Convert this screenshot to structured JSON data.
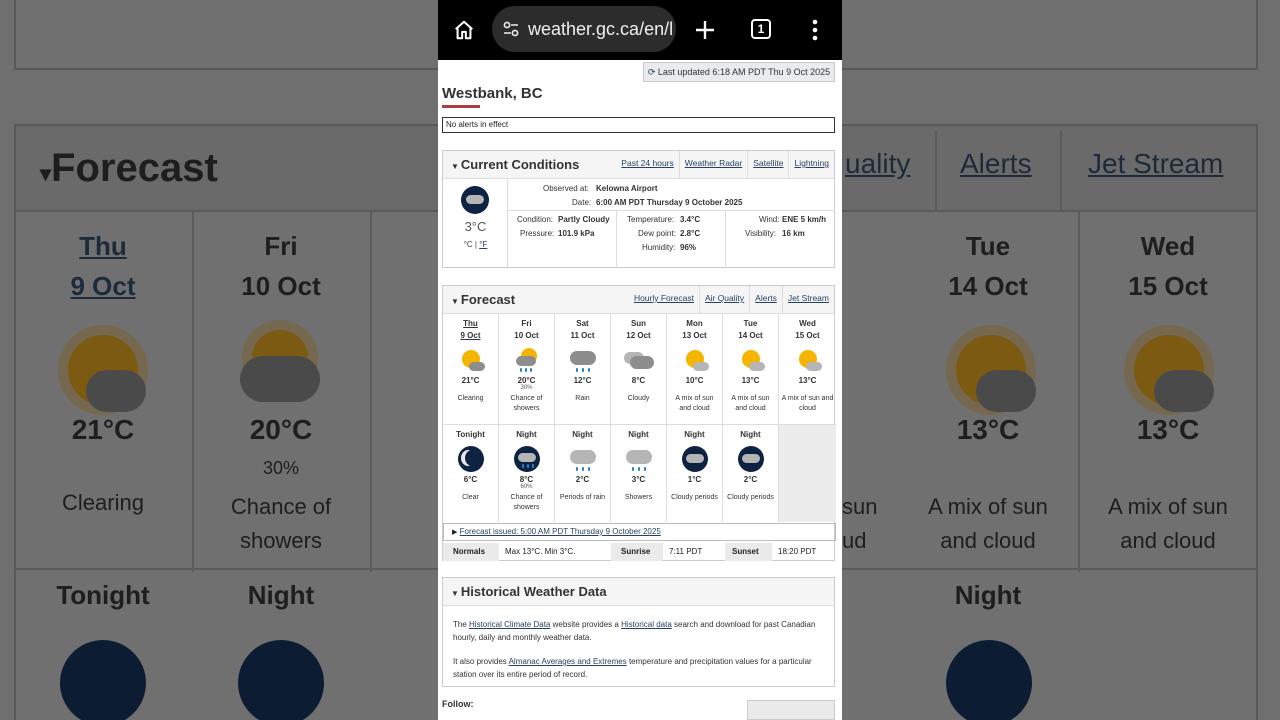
{
  "browser": {
    "url": "weather.gc.ca/en/l",
    "tab_count": "1"
  },
  "page": {
    "last_updated": "Last updated 6:18 AM PDT Thu 9 Oct 2025",
    "city": "Westbank, BC",
    "alerts": "No alerts in effect"
  },
  "current": {
    "title": "Current Conditions",
    "links": [
      "Past 24 hours",
      "Weather Radar",
      "Satellite",
      "Lightning"
    ],
    "temp": "3°C",
    "unit_c": "°C",
    "unit_f": "°F",
    "observed_label": "Observed at:",
    "observed_value": "Kelowna Airport",
    "date_label": "Date:",
    "date_value": "6:00 AM PDT Thursday 9 October 2025",
    "condition_label": "Condition:",
    "condition_value": "Partly Cloudy",
    "pressure_label": "Pressure:",
    "pressure_value": "101.9 kPa",
    "temperature_label": "Temperature:",
    "temperature_value": "3.4°C",
    "dewpoint_label": "Dew point:",
    "dewpoint_value": "2.8°C",
    "humidity_label": "Humidity:",
    "humidity_value": "96%",
    "wind_label": "Wind:",
    "wind_value": "ENE 5 km/h",
    "visibility_label": "Visibility:",
    "visibility_value": "16 km"
  },
  "forecast": {
    "title": "Forecast",
    "links": [
      "Hourly Forecast",
      "Air Quality",
      "Alerts",
      "Jet Stream"
    ],
    "days": [
      {
        "name": "Thu",
        "date": "9 Oct",
        "temp": "21°C",
        "pop": "",
        "summary": "Clearing",
        "icon": "sun-cloud-icon"
      },
      {
        "name": "Fri",
        "date": "10 Oct",
        "temp": "20°C",
        "pop": "30%",
        "summary": "Chance of showers",
        "icon": "sun-cloud-rain-icon"
      },
      {
        "name": "Sat",
        "date": "11 Oct",
        "temp": "12°C",
        "pop": "",
        "summary": "Rain",
        "icon": "rain-cloud-icon"
      },
      {
        "name": "Sun",
        "date": "12 Oct",
        "temp": "8°C",
        "pop": "",
        "summary": "Cloudy",
        "icon": "cloud-icon"
      },
      {
        "name": "Mon",
        "date": "13 Oct",
        "temp": "10°C",
        "pop": "",
        "summary": "A mix of sun and cloud",
        "icon": "sun-cloud-icon"
      },
      {
        "name": "Tue",
        "date": "14 Oct",
        "temp": "13°C",
        "pop": "",
        "summary": "A mix of sun and cloud",
        "icon": "sun-cloud-icon"
      },
      {
        "name": "Wed",
        "date": "15 Oct",
        "temp": "13°C",
        "pop": "",
        "summary": "A mix of sun and cloud",
        "icon": "sun-cloud-icon"
      }
    ],
    "nights": [
      {
        "name": "Tonight",
        "temp": "6°C",
        "pop": "",
        "summary": "Clear",
        "icon": "moon-icon"
      },
      {
        "name": "Night",
        "temp": "8°C",
        "pop": "60%",
        "summary": "Chance of showers",
        "icon": "moon-cloud-rain-icon"
      },
      {
        "name": "Night",
        "temp": "2°C",
        "pop": "",
        "summary": "Periods of rain",
        "icon": "rain-cloud-icon"
      },
      {
        "name": "Night",
        "temp": "3°C",
        "pop": "",
        "summary": "Showers",
        "icon": "rain-cloud-icon"
      },
      {
        "name": "Night",
        "temp": "1°C",
        "pop": "",
        "summary": "Cloudy periods",
        "icon": "moon-cloud-icon"
      },
      {
        "name": "Night",
        "temp": "2°C",
        "pop": "",
        "summary": "Cloudy periods",
        "icon": "moon-cloud-icon"
      }
    ],
    "issued": "Forecast issued: 5:00 AM PDT Thursday 9 October 2025",
    "normals_label": "Normals",
    "normals_value": "Max 13°C. Min 3°C.",
    "sunrise_label": "Sunrise",
    "sunrise_value": "7:11 PDT",
    "sunset_label": "Sunset",
    "sunset_value": "18:20 PDT"
  },
  "historical": {
    "title": "Historical Weather Data",
    "p1_a": "The ",
    "p1_link1": "Historical Climate Data",
    "p1_b": " website provides a ",
    "p1_link2": "Historical data",
    "p1_c": " search and download for past Canadian hourly, daily and monthly weather data.",
    "p2_a": "It also provides ",
    "p2_link": "Almanac Averages and Extremes",
    "p2_b": " temperature and precipitation values for a particular station over its entire period of record."
  },
  "footer": {
    "follow": "Follow:"
  },
  "background": {
    "forecast_title": "Forecast",
    "links": [
      "uality",
      "Alerts",
      "Jet Stream"
    ],
    "day1_name": "Thu",
    "day1_date": "9 Oct",
    "day1_temp": "21°C",
    "day1_summary": "Clearing",
    "day2_name": "Fri",
    "day2_date": "10 Oct",
    "day2_temp": "20°C",
    "day2_pop": "30%",
    "day2_summary_1": "Chance of",
    "day2_summary_2": "showers",
    "day6_name": "Tue",
    "day6_date": "14 Oct",
    "day6_temp": "13°C",
    "day7_name": "Wed",
    "day7_date": "15 Oct",
    "day7_temp": "13°C",
    "mix_1": "A mix of sun",
    "mix_2": "and cloud",
    "left_partial_1": "sun",
    "left_partial_2": "ud",
    "tonight": "Tonight",
    "night": "Night"
  }
}
